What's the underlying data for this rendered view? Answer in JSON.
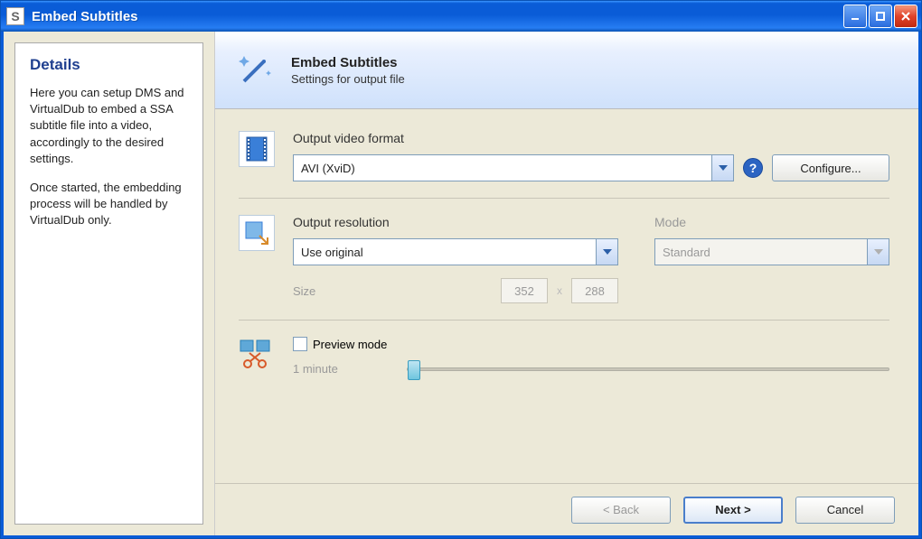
{
  "window": {
    "title": "Embed Subtitles"
  },
  "details": {
    "heading": "Details",
    "para1": "Here you can setup DMS and VirtualDub to embed a SSA subtitle file into a video, accordingly to the desired settings.",
    "para2": "Once started, the embedding process will be handled by VirtualDub only."
  },
  "header": {
    "title": "Embed Subtitles",
    "subtitle": "Settings for output file"
  },
  "format": {
    "label": "Output video format",
    "value": "AVI (XviD)",
    "configure": "Configure..."
  },
  "resolution": {
    "label": "Output resolution",
    "value": "Use original",
    "size_label": "Size",
    "width": "352",
    "height": "288",
    "mode_label": "Mode",
    "mode_value": "Standard"
  },
  "preview": {
    "label": "Preview mode",
    "duration": "1 minute"
  },
  "footer": {
    "back": "< Back",
    "next": "Next >",
    "cancel": "Cancel"
  }
}
